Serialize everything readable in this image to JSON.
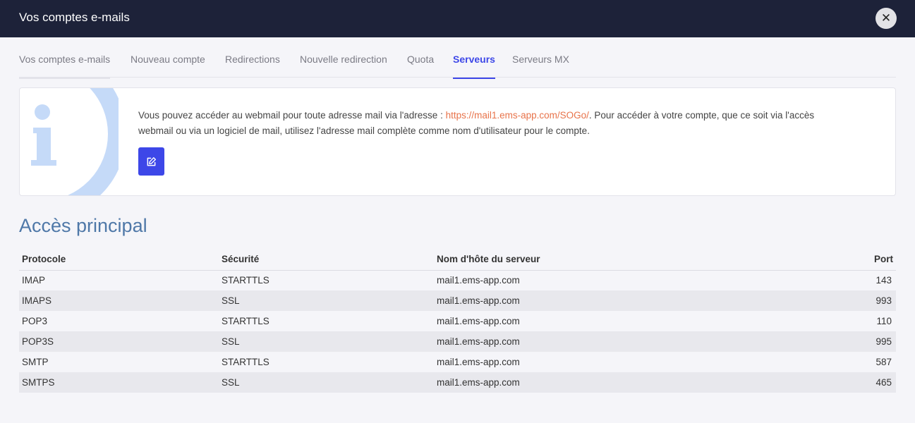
{
  "header": {
    "title": "Vos comptes e-mails",
    "close_label": "✕"
  },
  "tabs": [
    {
      "label": "Vos comptes e-mails"
    },
    {
      "label": "Nouveau compte"
    },
    {
      "label": "Redirections"
    },
    {
      "label": "Nouvelle redirection"
    },
    {
      "label": "Quota"
    },
    {
      "label": "Serveurs",
      "active": true
    },
    {
      "label": "Serveurs MX"
    }
  ],
  "info": {
    "icon": "info-icon",
    "text_before": "Vous pouvez accéder au webmail pour toute adresse mail via l'adresse : ",
    "link": "https://mail1.ems-app.com/SOGo/",
    "text_after": ". Pour accéder à votre compte, que ce soit via l'accès webmail ou via un logiciel de mail, utilisez l'adresse mail complète comme nom d'utilisateur pour le compte.",
    "edit_icon": "edit-icon"
  },
  "section": {
    "title": "Accès principal"
  },
  "table": {
    "headers": [
      "Protocole",
      "Sécurité",
      "Nom d'hôte du serveur",
      "Port"
    ],
    "rows": [
      [
        "IMAP",
        "STARTTLS",
        "mail1.ems-app.com",
        "143"
      ],
      [
        "IMAPS",
        "SSL",
        "mail1.ems-app.com",
        "993"
      ],
      [
        "POP3",
        "STARTTLS",
        "mail1.ems-app.com",
        "110"
      ],
      [
        "POP3S",
        "SSL",
        "mail1.ems-app.com",
        "995"
      ],
      [
        "SMTP",
        "STARTTLS",
        "mail1.ems-app.com",
        "587"
      ],
      [
        "SMTPS",
        "SSL",
        "mail1.ems-app.com",
        "465"
      ]
    ]
  },
  "colors": {
    "topbar": "#1d2239",
    "accent": "#3d47e8",
    "link": "#e8734a",
    "section_title": "#4f78a8",
    "info_deco": "#c5daf8"
  }
}
